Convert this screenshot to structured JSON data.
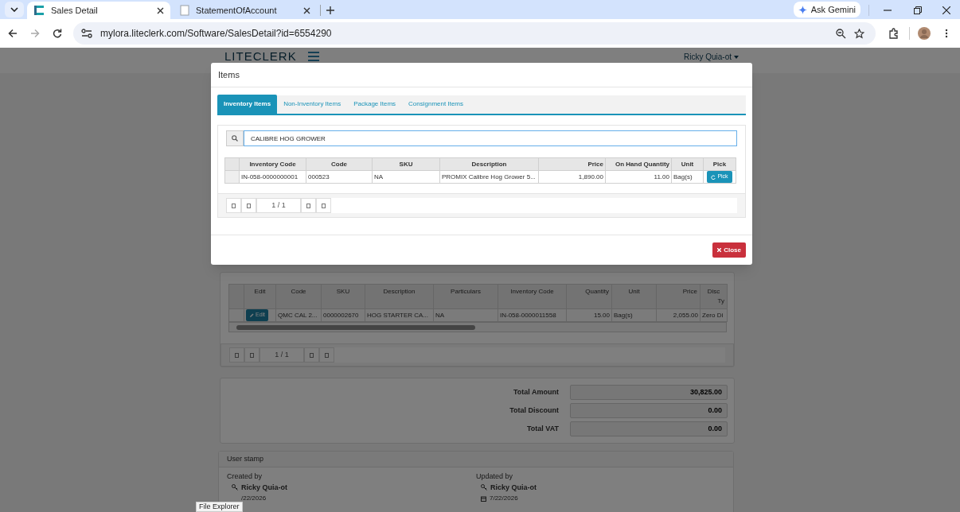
{
  "browser": {
    "tabs": [
      {
        "title": "Sales Detail",
        "selected": true
      },
      {
        "title": "StatementOfAccount",
        "selected": false
      }
    ],
    "ask_button": "Ask Gemini",
    "url": "mylora.liteclerk.com/Software/SalesDetail?id=6554290"
  },
  "app": {
    "logo": "LITECLERK",
    "user": "Ricky Quia-ot"
  },
  "sales_lines": {
    "columns": [
      {
        "label": "Edit"
      },
      {
        "label": "Code"
      },
      {
        "label": "SKU"
      },
      {
        "label": "Description"
      },
      {
        "label": "Particulars"
      },
      {
        "label": "Inventory Code"
      },
      {
        "label": "Quantity"
      },
      {
        "label": "Unit"
      },
      {
        "label": "Price"
      },
      {
        "label": "Disc",
        "label_line_2": "Ty"
      }
    ],
    "rows": [
      {
        "cells": [
          "Edit",
          "QMC CAL 2...",
          "0000002670",
          "HOG STARTER CA...",
          "NA",
          "IN-058-0000011558",
          "15.00",
          "Bag(s)",
          "2,055.00",
          "Zero Di"
        ]
      }
    ],
    "pager": "1 / 1"
  },
  "totals": [
    {
      "label": "Total Amount",
      "value": "30,825.00"
    },
    {
      "label": "Total Discount",
      "value": "0.00"
    },
    {
      "label": "Total VAT",
      "value": "0.00"
    }
  ],
  "user_stamp": {
    "title": "User stamp",
    "created": {
      "label": "Created by",
      "user": "Ricky Quia-ot",
      "date": "/22/2026"
    },
    "updated": {
      "label": "Updated by",
      "user": "Ricky Quia-ot",
      "date": "7/22/2026"
    }
  },
  "modal": {
    "title": "Items",
    "tabs": [
      {
        "label": "Inventory Items",
        "selected": true
      },
      {
        "label": "Non-Inventory Items",
        "selected": false
      },
      {
        "label": "Package Items",
        "selected": false
      },
      {
        "label": "Consignment Items",
        "selected": false
      }
    ],
    "search_value": "CALIBRE HOG GROWER",
    "columns": [
      {
        "label": "Inventory Code"
      },
      {
        "label": "Code"
      },
      {
        "label": "SKU"
      },
      {
        "label": "Description"
      },
      {
        "label": "Price"
      },
      {
        "label": "On Hand Quantity"
      },
      {
        "label": "Unit"
      },
      {
        "label": "Pick"
      }
    ],
    "rows": [
      {
        "cells": [
          "IN-058-0000000001",
          "000523",
          "NA",
          "PROMIX Calibre Hog Grower 5...",
          "1,890.00",
          "11.00",
          "Bag(s)",
          "Pick"
        ]
      }
    ],
    "pager": "1 / 1",
    "close_button": "Close"
  },
  "tooltip": "File Explorer"
}
